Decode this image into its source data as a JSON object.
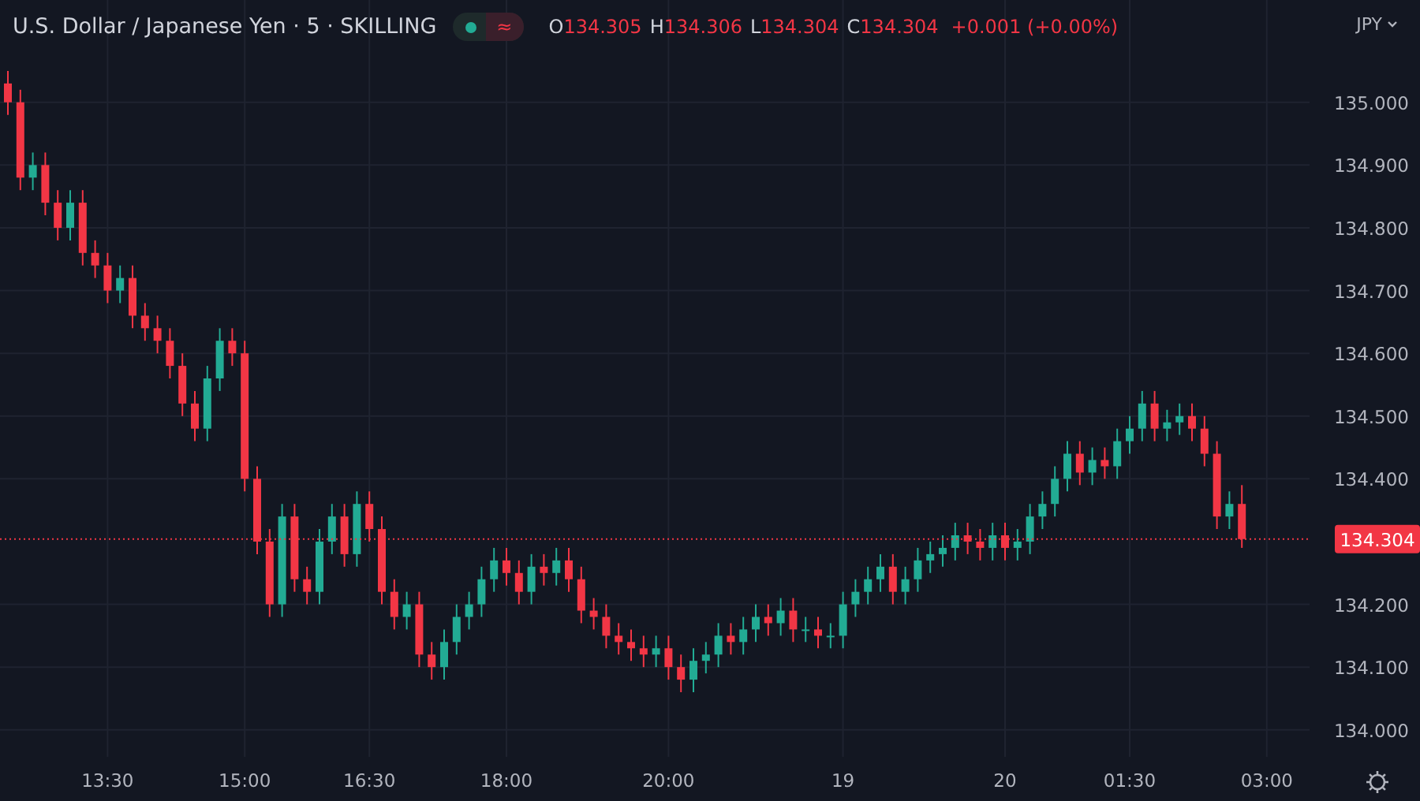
{
  "header": {
    "title": "U.S. Dollar / Japanese Yen · 5 · SKILLING",
    "market_open": true,
    "data_problem_badge": "≈",
    "ohlc": [
      {
        "label": "O",
        "value": "134.305"
      },
      {
        "label": "H",
        "value": "134.306"
      },
      {
        "label": "L",
        "value": "134.304"
      },
      {
        "label": "C",
        "value": "134.304"
      }
    ],
    "change": "+0.001 (+0.00%)"
  },
  "currency": "JPY",
  "chart": {
    "chart_data": {
      "type": "candlestick",
      "grid": true,
      "ylim": [
        133.957,
        135.163
      ],
      "categories": [
        null,
        null,
        null,
        null,
        null,
        null,
        null,
        null,
        "13:30",
        null,
        null,
        null,
        null,
        null,
        null,
        null,
        null,
        null,
        null,
        "15:00",
        null,
        null,
        null,
        null,
        null,
        null,
        null,
        null,
        null,
        "16:30",
        null,
        null,
        null,
        null,
        null,
        null,
        null,
        null,
        null,
        null,
        "18:00",
        null,
        null,
        null,
        null,
        null,
        null,
        null,
        null,
        null,
        null,
        null,
        null,
        "20:00",
        null,
        null,
        null,
        null,
        null,
        null,
        null,
        null,
        null,
        null,
        null,
        null,
        null,
        "19",
        null,
        null,
        null,
        null,
        null,
        null,
        null,
        null,
        null,
        null,
        null,
        null,
        "20",
        null,
        null,
        null,
        null,
        null,
        null,
        null,
        null,
        null,
        "01:30",
        null,
        null,
        null,
        null,
        null,
        null,
        null,
        null,
        null,
        null,
        "03:00"
      ],
      "ohlc": [
        [
          135.03,
          135.05,
          134.98,
          135.0
        ],
        [
          135.0,
          135.02,
          134.86,
          134.88
        ],
        [
          134.88,
          134.92,
          134.86,
          134.9
        ],
        [
          134.9,
          134.92,
          134.82,
          134.84
        ],
        [
          134.84,
          134.86,
          134.78,
          134.8
        ],
        [
          134.8,
          134.86,
          134.78,
          134.84
        ],
        [
          134.84,
          134.86,
          134.74,
          134.76
        ],
        [
          134.76,
          134.78,
          134.72,
          134.74
        ],
        [
          134.74,
          134.76,
          134.68,
          134.7
        ],
        [
          134.7,
          134.74,
          134.68,
          134.72
        ],
        [
          134.72,
          134.74,
          134.64,
          134.66
        ],
        [
          134.66,
          134.68,
          134.62,
          134.64
        ],
        [
          134.64,
          134.66,
          134.6,
          134.62
        ],
        [
          134.62,
          134.64,
          134.56,
          134.58
        ],
        [
          134.58,
          134.6,
          134.5,
          134.52
        ],
        [
          134.52,
          134.54,
          134.46,
          134.48
        ],
        [
          134.48,
          134.58,
          134.46,
          134.56
        ],
        [
          134.56,
          134.64,
          134.54,
          134.62
        ],
        [
          134.62,
          134.64,
          134.58,
          134.6
        ],
        [
          134.6,
          134.62,
          134.38,
          134.4
        ],
        [
          134.4,
          134.42,
          134.28,
          134.3
        ],
        [
          134.3,
          134.32,
          134.18,
          134.2
        ],
        [
          134.2,
          134.36,
          134.18,
          134.34
        ],
        [
          134.34,
          134.36,
          134.22,
          134.24
        ],
        [
          134.24,
          134.26,
          134.2,
          134.22
        ],
        [
          134.22,
          134.32,
          134.2,
          134.3
        ],
        [
          134.3,
          134.36,
          134.28,
          134.34
        ],
        [
          134.34,
          134.36,
          134.26,
          134.28
        ],
        [
          134.28,
          134.38,
          134.26,
          134.36
        ],
        [
          134.36,
          134.38,
          134.3,
          134.32
        ],
        [
          134.32,
          134.34,
          134.2,
          134.22
        ],
        [
          134.22,
          134.24,
          134.16,
          134.18
        ],
        [
          134.18,
          134.22,
          134.16,
          134.2
        ],
        [
          134.2,
          134.22,
          134.1,
          134.12
        ],
        [
          134.12,
          134.14,
          134.08,
          134.1
        ],
        [
          134.1,
          134.16,
          134.08,
          134.14
        ],
        [
          134.14,
          134.2,
          134.12,
          134.18
        ],
        [
          134.18,
          134.22,
          134.16,
          134.2
        ],
        [
          134.2,
          134.26,
          134.18,
          134.24
        ],
        [
          134.24,
          134.29,
          134.22,
          134.27
        ],
        [
          134.27,
          134.29,
          134.23,
          134.25
        ],
        [
          134.25,
          134.27,
          134.2,
          134.22
        ],
        [
          134.22,
          134.28,
          134.2,
          134.26
        ],
        [
          134.26,
          134.28,
          134.23,
          134.25
        ],
        [
          134.25,
          134.29,
          134.23,
          134.27
        ],
        [
          134.27,
          134.29,
          134.22,
          134.24
        ],
        [
          134.24,
          134.26,
          134.17,
          134.19
        ],
        [
          134.19,
          134.21,
          134.16,
          134.18
        ],
        [
          134.18,
          134.2,
          134.13,
          134.15
        ],
        [
          134.15,
          134.17,
          134.12,
          134.14
        ],
        [
          134.14,
          134.16,
          134.11,
          134.13
        ],
        [
          134.13,
          134.15,
          134.1,
          134.12
        ],
        [
          134.12,
          134.15,
          134.1,
          134.13
        ],
        [
          134.13,
          134.15,
          134.08,
          134.1
        ],
        [
          134.1,
          134.12,
          134.06,
          134.08
        ],
        [
          134.08,
          134.13,
          134.06,
          134.11
        ],
        [
          134.11,
          134.14,
          134.09,
          134.12
        ],
        [
          134.12,
          134.17,
          134.1,
          134.15
        ],
        [
          134.15,
          134.17,
          134.12,
          134.14
        ],
        [
          134.14,
          134.18,
          134.12,
          134.16
        ],
        [
          134.16,
          134.2,
          134.14,
          134.18
        ],
        [
          134.18,
          134.2,
          134.15,
          134.17
        ],
        [
          134.17,
          134.21,
          134.15,
          134.19
        ],
        [
          134.19,
          134.21,
          134.14,
          134.16
        ],
        [
          134.16,
          134.18,
          134.14,
          134.16
        ],
        [
          134.16,
          134.18,
          134.13,
          134.15
        ],
        [
          134.15,
          134.17,
          134.13,
          134.15
        ],
        [
          134.15,
          134.22,
          134.13,
          134.2
        ],
        [
          134.2,
          134.24,
          134.18,
          134.22
        ],
        [
          134.22,
          134.26,
          134.2,
          134.24
        ],
        [
          134.24,
          134.28,
          134.22,
          134.26
        ],
        [
          134.26,
          134.28,
          134.2,
          134.22
        ],
        [
          134.22,
          134.26,
          134.2,
          134.24
        ],
        [
          134.24,
          134.29,
          134.22,
          134.27
        ],
        [
          134.27,
          134.3,
          134.25,
          134.28
        ],
        [
          134.28,
          134.31,
          134.26,
          134.29
        ],
        [
          134.29,
          134.33,
          134.27,
          134.31
        ],
        [
          134.31,
          134.33,
          134.28,
          134.3
        ],
        [
          134.3,
          134.32,
          134.27,
          134.29
        ],
        [
          134.29,
          134.33,
          134.27,
          134.31
        ],
        [
          134.31,
          134.33,
          134.27,
          134.29
        ],
        [
          134.29,
          134.32,
          134.27,
          134.3
        ],
        [
          134.3,
          134.36,
          134.28,
          134.34
        ],
        [
          134.34,
          134.38,
          134.32,
          134.36
        ],
        [
          134.36,
          134.42,
          134.34,
          134.4
        ],
        [
          134.4,
          134.46,
          134.38,
          134.44
        ],
        [
          134.44,
          134.46,
          134.39,
          134.41
        ],
        [
          134.41,
          134.45,
          134.39,
          134.43
        ],
        [
          134.43,
          134.45,
          134.4,
          134.42
        ],
        [
          134.42,
          134.48,
          134.4,
          134.46
        ],
        [
          134.46,
          134.5,
          134.44,
          134.48
        ],
        [
          134.48,
          134.54,
          134.46,
          134.52
        ],
        [
          134.52,
          134.54,
          134.46,
          134.48
        ],
        [
          134.48,
          134.51,
          134.46,
          134.49
        ],
        [
          134.49,
          134.52,
          134.47,
          134.5
        ],
        [
          134.5,
          134.52,
          134.46,
          134.48
        ],
        [
          134.48,
          134.5,
          134.42,
          134.44
        ],
        [
          134.44,
          134.46,
          134.32,
          134.34
        ],
        [
          134.34,
          134.38,
          134.32,
          134.36
        ],
        [
          134.36,
          134.39,
          134.29,
          134.304
        ],
        null,
        null
      ],
      "yticks": [
        {
          "value": 134.0,
          "label": "134.000"
        },
        {
          "value": 134.1,
          "label": "134.100"
        },
        {
          "value": 134.2,
          "label": "134.200"
        },
        {
          "value": 134.4,
          "label": "134.400"
        },
        {
          "value": 134.5,
          "label": "134.500"
        },
        {
          "value": 134.6,
          "label": "134.600"
        },
        {
          "value": 134.7,
          "label": "134.700"
        },
        {
          "value": 134.8,
          "label": "134.800"
        },
        {
          "value": 134.9,
          "label": "134.900"
        },
        {
          "value": 135.0,
          "label": "135.000"
        }
      ],
      "ref_lines": [
        {
          "axis": "y",
          "value": 134.304,
          "label": "134.304",
          "color": "#f23645"
        }
      ]
    }
  }
}
